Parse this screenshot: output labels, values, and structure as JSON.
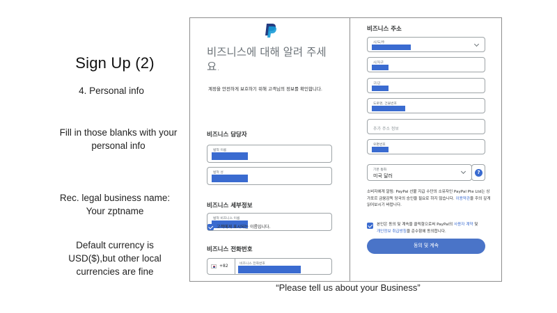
{
  "slide": {
    "title": "Sign Up (2)",
    "step": "4. Personal info",
    "instruction": "Fill in those blanks with your personal info",
    "legal_name_tip": "Rec. legal business name: Your zptname",
    "currency_tip": "Default currency is USD($),but other local currencies are fine",
    "caption": "“Please tell us about your Business”"
  },
  "form_left": {
    "heading": "비즈니스에 대해 알려 주세요.",
    "intro": "계정을 안전하게 보호하기 위해 고객님의 정보를 확인합니다.",
    "contact_section": "비즈니스 담당자",
    "first_name_label": "법적 이름",
    "last_name_label": "법적 성",
    "details_section": "비즈니스 세부정보",
    "legal_business_name_label": "법적 비즈니스 이름",
    "display_name_checkbox": "고객에게 표시되는 이름입니다.",
    "phone_section": "비즈니스 전화번호",
    "phone_code": "+82",
    "phone_label": "비즈니스 전화번호"
  },
  "form_right": {
    "address_section": "비즈니스 주소",
    "province_label": "시/도/주",
    "city_label": "시/자구",
    "district_label": "구/군",
    "street_label": "도로명, 건물번호",
    "extra_address_placeholder": "추가 주소 정보",
    "postal_label": "우편번호",
    "currency_label": "기본 통화",
    "currency_value": "미국 달러",
    "help_icon": "?",
    "disclaimer_part1": "소비자에게 알림: PayPal 선불 지급 수단의 소유자인 PayPal Pte Ltd는 싱가포르 금융감독 당국의 승인을 필요로 하지 않습니다. ",
    "disclaimer_link": "이용약관",
    "disclaimer_part2": "을 주의 깊게 읽어보시기 바랍니다.",
    "agree_part1": "본인은 동의 및 계속을 클릭함으로써 PayPal의 ",
    "agree_link1": "사용자 계약",
    "agree_mid": " 및 ",
    "agree_link2": "개인정보 취급방침",
    "agree_part2": "을 준수함에 동의합니다.",
    "submit_label": "동의 및 계속"
  },
  "colors": {
    "accent": "#3a6bd0",
    "button": "#4a74c8",
    "logo_dark": "#253b80",
    "logo_light": "#179bd7"
  }
}
